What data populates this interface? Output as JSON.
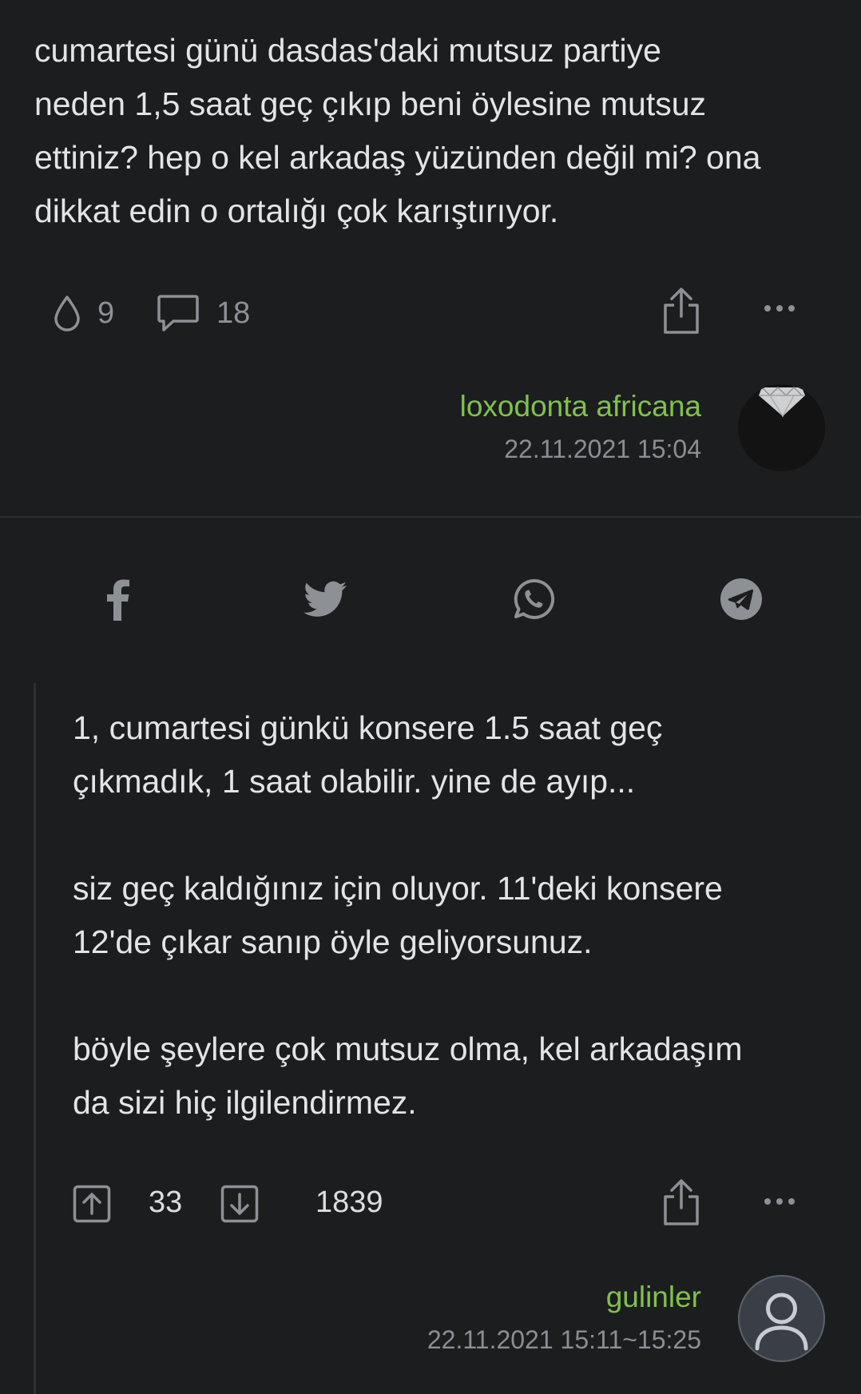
{
  "entry": {
    "text": "cumartesi günü dasdas'daki mutsuz partiye\nneden 1,5 saat geç çıkıp beni öylesine mutsuz\nettiniz? hep o kel arkadaş yüzünden değil mi? ona\ndikkat edin o ortalığı çok karıştırıyor.",
    "drops": "9",
    "comments": "18",
    "author": "loxodonta africana",
    "date": "22.11.2021 15:04"
  },
  "share": {
    "icons": [
      "facebook-icon",
      "twitter-icon",
      "whatsapp-icon",
      "telegram-icon"
    ]
  },
  "comment": {
    "text": "1, cumartesi günkü konsere 1.5 saat geç\nçıkmadık, 1 saat olabilir. yine de ayıp...\n\nsiz geç kaldığınız için oluyor. 11'deki konsere\n12'de çıkar sanıp öyle geliyorsunuz.\n\nböyle şeylere çok mutsuz olma, kel arkadaşım\nda sizi hiç ilgilendirmez.",
    "upvotes": "33",
    "score": "1839",
    "author": "gulinler",
    "date": "22.11.2021 15:11~15:25"
  },
  "colors": {
    "background": "#1c1d1f",
    "author": "#81c14b",
    "muted": "#8b8e93",
    "text": "#e3e4e5"
  }
}
